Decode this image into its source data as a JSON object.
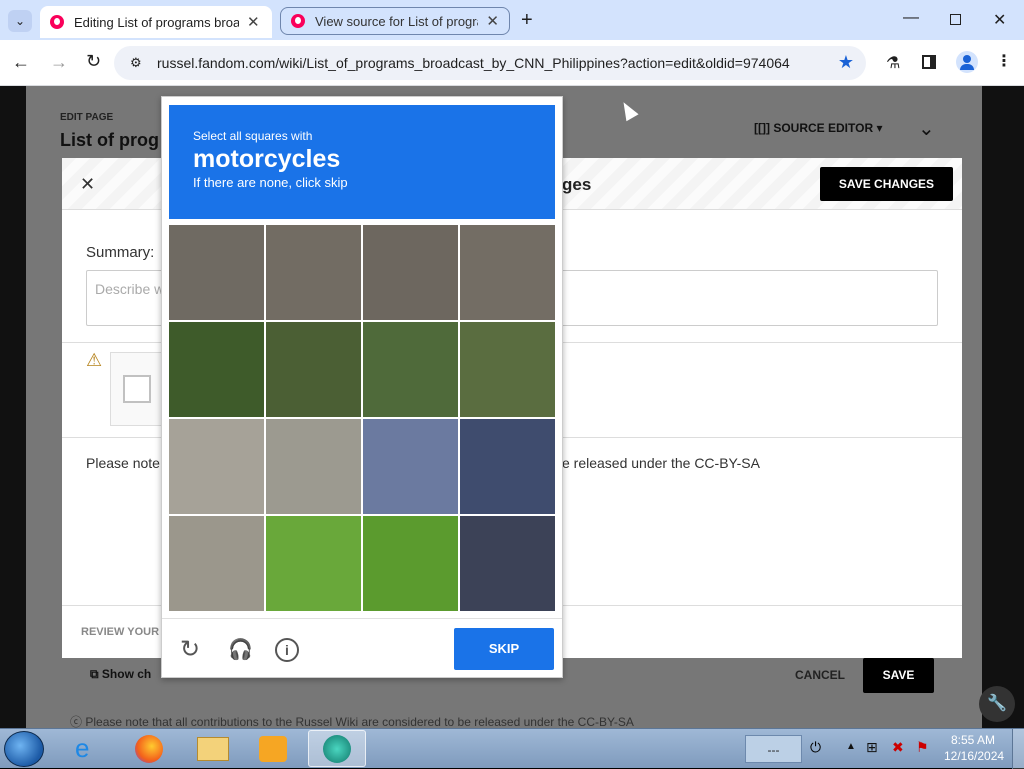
{
  "browser": {
    "tabs": [
      {
        "title": "Editing List of programs broadc"
      },
      {
        "title": "View source for List of program"
      }
    ],
    "url": "russel.fandom.com/wiki/List_of_programs_broadcast_by_CNN_Philippines?action=edit&oldid=974064"
  },
  "page": {
    "edit_page_label": "EDIT PAGE",
    "page_title_partial": "List of prog",
    "source_editor": "SOURCE EDITOR",
    "modal_title_partial": "ges",
    "save_changes": "SAVE CHANGES",
    "summary_label": "Summary:",
    "summary_placeholder": "Describe w",
    "license_left": "Please note",
    "license_right": "e released under the CC-BY-SA",
    "review_label": "REVIEW YOUR",
    "show_changes_partial": "Show ch",
    "cancel": "CANCEL",
    "save": "SAVE",
    "footer_note": "Please note that all contributions to the Russel Wiki are considered to be released under the CC-BY-SA"
  },
  "captcha": {
    "instruction": "Select all squares with",
    "target": "motorcycles",
    "hint": "If there are none, click skip",
    "skip": "SKIP"
  },
  "taskbar": {
    "time": "8:55 AM",
    "date": "12/16/2024",
    "lang": "---"
  }
}
